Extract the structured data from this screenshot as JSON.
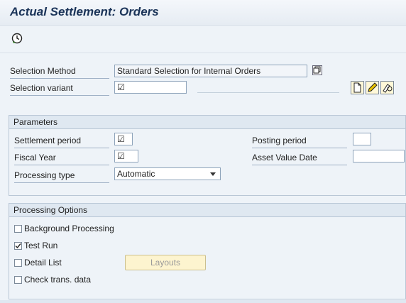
{
  "window": {
    "title": "Actual Settlement: Orders"
  },
  "toolbar": {
    "execute_icon": "execute-clock-icon"
  },
  "selection": {
    "method_label": "Selection Method",
    "method_value": "Standard Selection for Internal Orders",
    "variant_label": "Selection variant",
    "variant_value": "☑",
    "variant_buttons": [
      "create-icon",
      "edit-icon",
      "copy-icon"
    ]
  },
  "parameters": {
    "header": "Parameters",
    "settlement_period_label": "Settlement period",
    "settlement_period_value": "☑",
    "fiscal_year_label": "Fiscal Year",
    "fiscal_year_value": "☑",
    "processing_type_label": "Processing type",
    "processing_type_value": "Automatic",
    "posting_period_label": "Posting period",
    "posting_period_value": "",
    "asset_value_date_label": "Asset Value Date",
    "asset_value_date_value": ""
  },
  "processing_options": {
    "header": "Processing Options",
    "background_label": "Background Processing",
    "background_checked": false,
    "test_run_label": "Test Run",
    "test_run_checked": true,
    "detail_list_label": "Detail List",
    "detail_list_checked": false,
    "check_trans_label": "Check trans. data",
    "check_trans_checked": false,
    "layouts_button": "Layouts"
  },
  "colors": {
    "title": "#1a3358",
    "panel": "#eef3f8",
    "button_yellow": "#fdf4cf"
  }
}
